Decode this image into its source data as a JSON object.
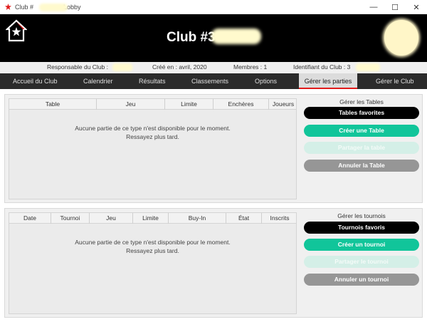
{
  "window": {
    "title_prefix": "Club #",
    "title_suffix": "Lobby",
    "minimize": "—",
    "maximize": "☐",
    "close": "✕"
  },
  "header": {
    "club_prefix": "Club #3"
  },
  "info": {
    "manager": "Responsable du Club :",
    "created": "Créé en : avril, 2020",
    "members": "Membres : 1",
    "club_id": "Identifiant du Club : 3"
  },
  "nav": [
    "Accueil du Club",
    "Calendrier",
    "Résultats",
    "Classements",
    "Options",
    "Gérer les parties",
    "Gérer le Club"
  ],
  "tables": {
    "columns": [
      "Table",
      "Jeu",
      "Limite",
      "Enchères",
      "Joueurs"
    ],
    "empty_line1": "Aucune partie de ce type n'est disponible pour le moment.",
    "empty_line2": "Ressayez plus tard.",
    "side_title": "Gérer les Tables",
    "btn_favorites": "Tables favorites",
    "btn_create": "Créer une Table",
    "btn_share": "Partager la table",
    "btn_cancel": "Annuler la Table"
  },
  "tournaments": {
    "columns": [
      "Date",
      "Tournoi",
      "Jeu",
      "Limite",
      "Buy-In",
      "État",
      "Inscrits"
    ],
    "empty_line1": "Aucune partie de ce type n'est disponible pour le moment.",
    "empty_line2": "Ressayez plus tard.",
    "side_title": "Gérer les tournois",
    "btn_favorites": "Tournois favoris",
    "btn_create": "Créer un tournoi",
    "btn_share": "Partager le tournoi",
    "btn_cancel": "Annuler un tournoi"
  },
  "colors": {
    "accent_red": "#e01b1b",
    "button_green": "#11c59a",
    "header_bg": "#000000",
    "nav_bg": "#2b2b2b"
  }
}
